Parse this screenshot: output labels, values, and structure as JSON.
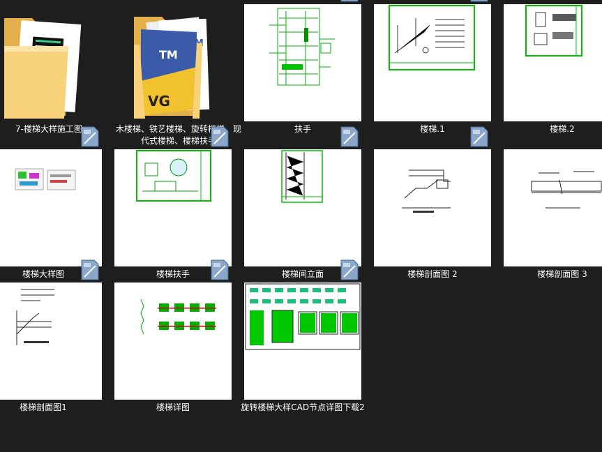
{
  "files": [
    {
      "name": "7-楼梯大样施工图",
      "kind": "folder"
    },
    {
      "name": "木楼梯、铁艺楼梯、旋转楼梯、现代式楼梯、楼梯扶手",
      "kind": "folder",
      "cover_text_1": "TM",
      "cover_text_2": "TM",
      "cover_text_3": "VG"
    },
    {
      "name": "扶手",
      "kind": "dwg"
    },
    {
      "name": "楼梯.1",
      "kind": "dwg"
    },
    {
      "name": "楼梯.2",
      "kind": "dwg"
    },
    {
      "name": "楼梯大样图",
      "kind": "dwg"
    },
    {
      "name": "楼梯扶手",
      "kind": "dwg"
    },
    {
      "name": "楼梯间立面",
      "kind": "dwg"
    },
    {
      "name": "楼梯剖面图 2",
      "kind": "dwg"
    },
    {
      "name": "楼梯剖面图 3",
      "kind": "dwg"
    },
    {
      "name": "楼梯剖面图1",
      "kind": "dwg"
    },
    {
      "name": "楼梯详图",
      "kind": "dwg"
    },
    {
      "name": "旋转楼梯大样CAD节点详图下载2",
      "kind": "dwg"
    }
  ],
  "colors": {
    "background": "#1e1e1e",
    "label": "#ffffff",
    "cad_green": "#00c800",
    "folder": "#f4c95d"
  }
}
